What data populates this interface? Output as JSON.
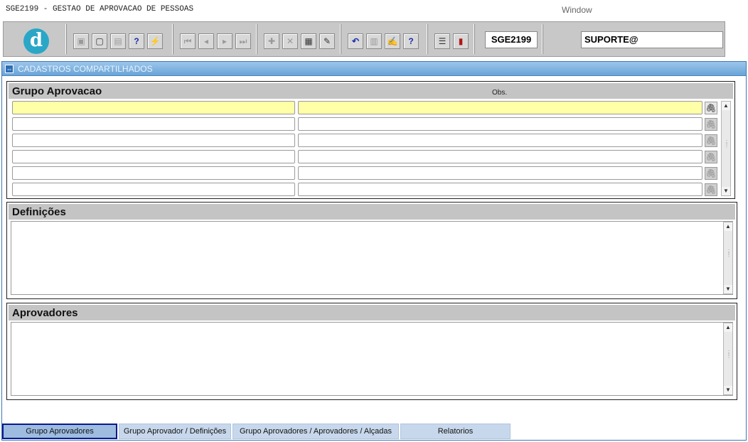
{
  "titlebar": {
    "title": "SGE2199 - GESTAO DE APROVACAO DE PESSOAS",
    "window_menu": "Window"
  },
  "toolbar": {
    "logo_letter": "d",
    "form_code": "SGE2199",
    "user": "SUPORTE@",
    "icons": [
      "save-icon",
      "print-preview-icon",
      "print-icon",
      "query-help-icon",
      "execute-query-icon",
      "first-record-icon",
      "previous-record-icon",
      "next-record-icon",
      "last-record-icon",
      "insert-record-icon",
      "delete-record-icon",
      "duplicate-record-icon",
      "clear-record-icon",
      "undo-icon",
      "clipboard-icon",
      "edit-icon",
      "help-icon",
      "menu-icon",
      "exit-icon"
    ]
  },
  "window": {
    "title": "CADASTROS COMPARTILHADOS",
    "grupo": {
      "title": "Grupo Aprovacao",
      "obs_label": "Obs."
    },
    "definicoes": {
      "title": "Definições"
    },
    "aprovadores": {
      "title": "Aprovadores"
    }
  },
  "tabs": [
    {
      "label": "Grupo Aprovadores",
      "active": true
    },
    {
      "label": "Grupo Aprovador / Definições",
      "active": false
    },
    {
      "label": "Grupo Aprovadores / Aprovadores / Alçadas",
      "active": false
    },
    {
      "label": "Relatorios",
      "active": false
    }
  ]
}
